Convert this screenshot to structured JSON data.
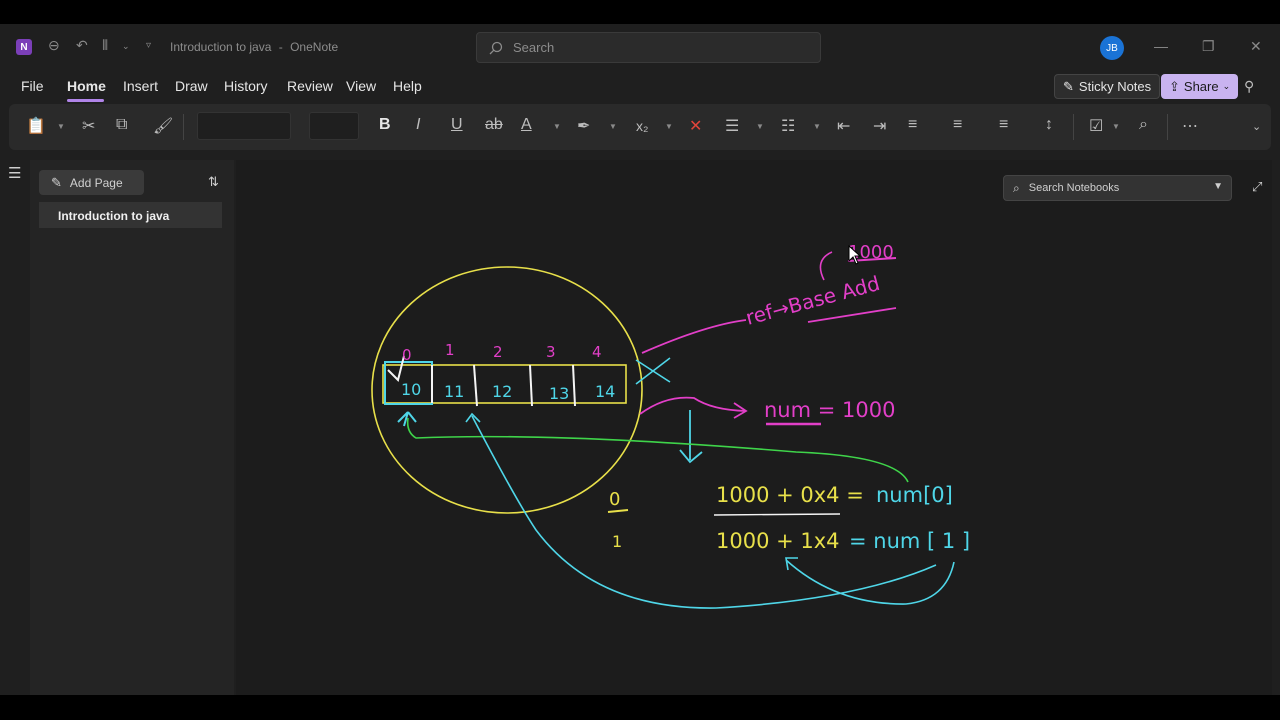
{
  "window": {
    "title": "Introduction to java",
    "app_name": "OneNote"
  },
  "titlebar": {
    "search_placeholder": "Search",
    "avatar_initials": "JB"
  },
  "menu": {
    "items": [
      "File",
      "Home",
      "Insert",
      "Draw",
      "History",
      "Review",
      "View",
      "Help"
    ],
    "active": "Home",
    "sticky_notes": "Sticky Notes",
    "share": "Share"
  },
  "pages": {
    "add_page": "Add Page",
    "items": [
      "Introduction to java"
    ]
  },
  "canvas": {
    "search_notebooks": "Search Notebooks"
  },
  "ink": {
    "top_value": "1000",
    "ref_label": "ref→Base Add",
    "indices": [
      "0",
      "1",
      "2",
      "3",
      "4"
    ],
    "values": [
      "10",
      "11",
      "12",
      "13",
      "14"
    ],
    "num_eq": "num = 1000",
    "formula1_left": "1000 + 0x4 =",
    "formula1_right": "num[0]",
    "formula2_left": "1000 + 1x4",
    "formula2_right": "= num [ 1 ]",
    "side_0": "0",
    "side_1": "1"
  },
  "colors": {
    "accent": "#b084e8",
    "ink_yellow": "#e8e04a",
    "ink_magenta": "#e23fc8",
    "ink_cyan": "#4fd6e8",
    "ink_green": "#3fd44a",
    "ink_white": "#f5f5f5"
  }
}
